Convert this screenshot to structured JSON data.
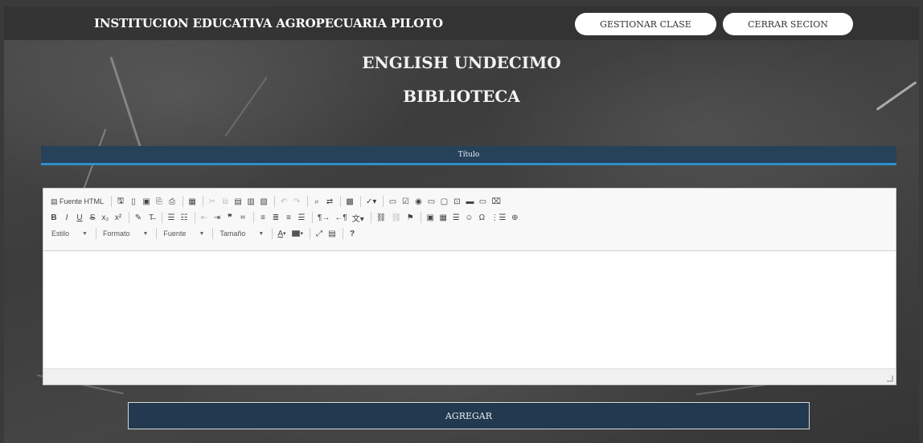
{
  "header": {
    "brand": "INSTITUCION EDUCATIVA AGROPECUARIA PILOTO",
    "gestionar_label": "GESTIONAR CLASE",
    "cerrar_label": "CERRAR SECION"
  },
  "main": {
    "course_title": "ENGLISH UNDECIMO",
    "section_title": "BIBLIOTECA",
    "title_field_label": "Título",
    "submit_label": "AGREGAR"
  },
  "editor": {
    "source_label": "Fuente HTML",
    "style_combo": "Estilo",
    "format_combo": "Formato",
    "font_combo": "Fuente",
    "size_combo": "Tamaño",
    "font_color_letter": "A",
    "help_label": "?",
    "bold": "B",
    "italic": "I",
    "underline": "U",
    "strike": "S",
    "subscript": "x₂",
    "superscript": "x²",
    "special_char": "Ω",
    "blockquote": "❞"
  },
  "colors": {
    "topbar_bg": "#323232",
    "titlebar_bg": "#26415a",
    "titlebar_accent": "#2e8fc9",
    "submit_bg": "#23394f"
  }
}
